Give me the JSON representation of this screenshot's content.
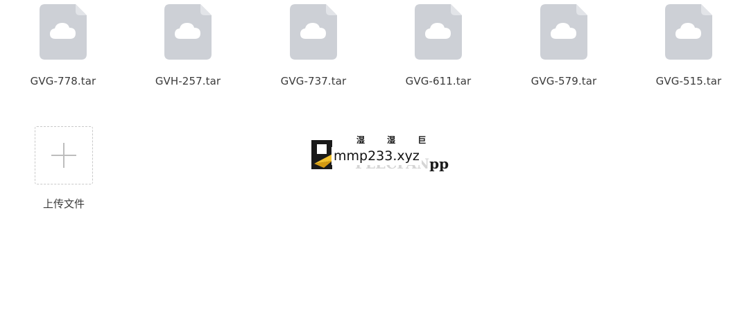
{
  "files": [
    {
      "name": "GVG-778.tar",
      "icon": "cloud-file-icon"
    },
    {
      "name": "GVH-257.tar",
      "icon": "cloud-file-icon"
    },
    {
      "name": "GVG-737.tar",
      "icon": "cloud-file-icon"
    },
    {
      "name": "GVG-611.tar",
      "icon": "cloud-file-icon"
    },
    {
      "name": "GVG-579.tar",
      "icon": "cloud-file-icon"
    },
    {
      "name": "GVG-515.tar",
      "icon": "cloud-file-icon"
    }
  ],
  "upload": {
    "label": "上传文件",
    "icon": "plus-icon"
  },
  "watermark": {
    "url": "mmp233.xyz",
    "top_glyphs": "湿 湿 巨",
    "bg_text": "PLECFAN",
    "bg_suffix": "pp"
  },
  "colors": {
    "file_icon": "#cdd0d6",
    "file_icon_fold": "#e2e4e8",
    "cloud": "#ffffff",
    "text": "#3a3a3a",
    "upload_border": "#c9c9c9",
    "plus": "#bdbdbd",
    "logo_dark": "#1a1a1a",
    "logo_accent": "#f2c12e"
  }
}
